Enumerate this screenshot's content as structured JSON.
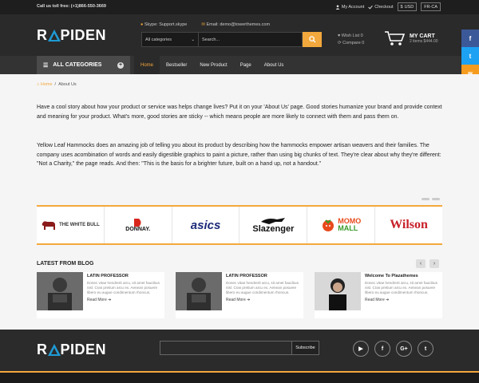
{
  "topbar": {
    "phone": "Call us toll free: (+1)866-550-3669",
    "account": "My Account",
    "checkout": "Checkout",
    "currency": "USD",
    "currency_symbol": "$",
    "language": "FR-CA"
  },
  "header": {
    "logo_text_1": "R",
    "logo_text_2": "PIDEN",
    "skype": "Skype: Support.skype",
    "email": "Email: demo@towerthemes.com",
    "category_select": "All categories",
    "search_placeholder": "Search...",
    "wishlist": "Wish List 0",
    "compare": "Compare 0",
    "cart_title": "MY CART",
    "cart_summary": "2 items $444.00"
  },
  "nav": {
    "all_categories": "ALL CATEGORIES",
    "items": [
      {
        "label": "Home"
      },
      {
        "label": "Bestseller"
      },
      {
        "label": "New Product"
      },
      {
        "label": "Page"
      },
      {
        "label": "About Us"
      }
    ]
  },
  "breadcrumb": {
    "home": "Home",
    "sep": "/",
    "current": "About Us"
  },
  "content": {
    "paragraph_1": "Have a cool story about how your product or service was helps change lives? Put it on your 'About Us' page. Good stories humanize your brand and provide context and meaning for your product. What's more, good stories are sticky -- which means people are more likely to connect with them and pass them on.",
    "paragraph_2": "Yellow Leaf Hammocks does an amazing job of telling you about its product by describing how the hammocks empower artisan weavers and their families. The company uses acombination of words and easily digestible graphics to paint a picture, rather than using big chunks of text. They're clear about why they're different: \"Not a Charity,\" the page reads. And then: \"This is the basis for a brighter future, built on a hand up, not a handout.\""
  },
  "brands": [
    {
      "name": "THE WHITE BULL"
    },
    {
      "name": "DONNAY."
    },
    {
      "name": "asics"
    },
    {
      "name": "Slazenger"
    },
    {
      "name": "MOMO MALL",
      "line1": "MOMO",
      "line2": "MALL"
    },
    {
      "name": "Wilson"
    }
  ],
  "blog": {
    "title": "LATEST FROM BLOG",
    "posts": [
      {
        "title": "LATIN PROFESSOR",
        "body": "Donec vitae hendrerit arcu, sit amet faucibus nisl. Cras pretium arcu ex. Aenean posuere libero eu augue condimentum rhoncus.",
        "more": "Read More"
      },
      {
        "title": "LATIN PROFESSOR",
        "body": "Donec vitae hendrerit arcu, sit amet faucibus nisl. Cras pretium arcu ex. Aenean posuere libero eu augue condimentum rhoncus.",
        "more": "Read More"
      },
      {
        "title": "Welcome To Plazathemes",
        "body": "Donec vitae hendrerit arcu, sit amet faucibus nisl. Cras pretium arcu ex. Aenean posuere libero eu augue condimentum rhoncus.",
        "more": "Read More"
      }
    ]
  },
  "footer": {
    "subscribe": "Subscribe"
  },
  "colors": {
    "accent": "#f2a83c",
    "logo_blue": "#1f9bd6",
    "dark": "#2a2a2a"
  }
}
